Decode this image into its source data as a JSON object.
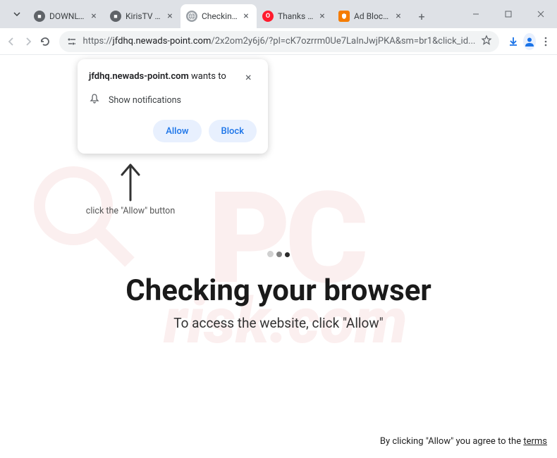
{
  "tabs": [
    {
      "title": "DOWNLOAD"
    },
    {
      "title": "KirisTV Dow"
    },
    {
      "title": "Checking y"
    },
    {
      "title": "Thanks for"
    },
    {
      "title": "Ad Blocker"
    }
  ],
  "toolbar": {
    "url_proto": "https://",
    "url_host": "jfdhq.newads-point.com",
    "url_path": "/2x2om2y6j6/?pl=cK7ozrrm0Ue7LaInJwjPKA&sm=br1&click_id..."
  },
  "perm": {
    "site": "jfdhq.newads-point.com",
    "wants": " wants to",
    "body": "Show notifications",
    "allow": "Allow",
    "block": "Block"
  },
  "hint": "click the \"Allow\" button",
  "main": {
    "heading": "Checking your browser",
    "sub": "To access the website, click \"Allow\""
  },
  "footer": {
    "prefix": "By clicking \"Allow\" you agree to the ",
    "terms": "terms"
  }
}
